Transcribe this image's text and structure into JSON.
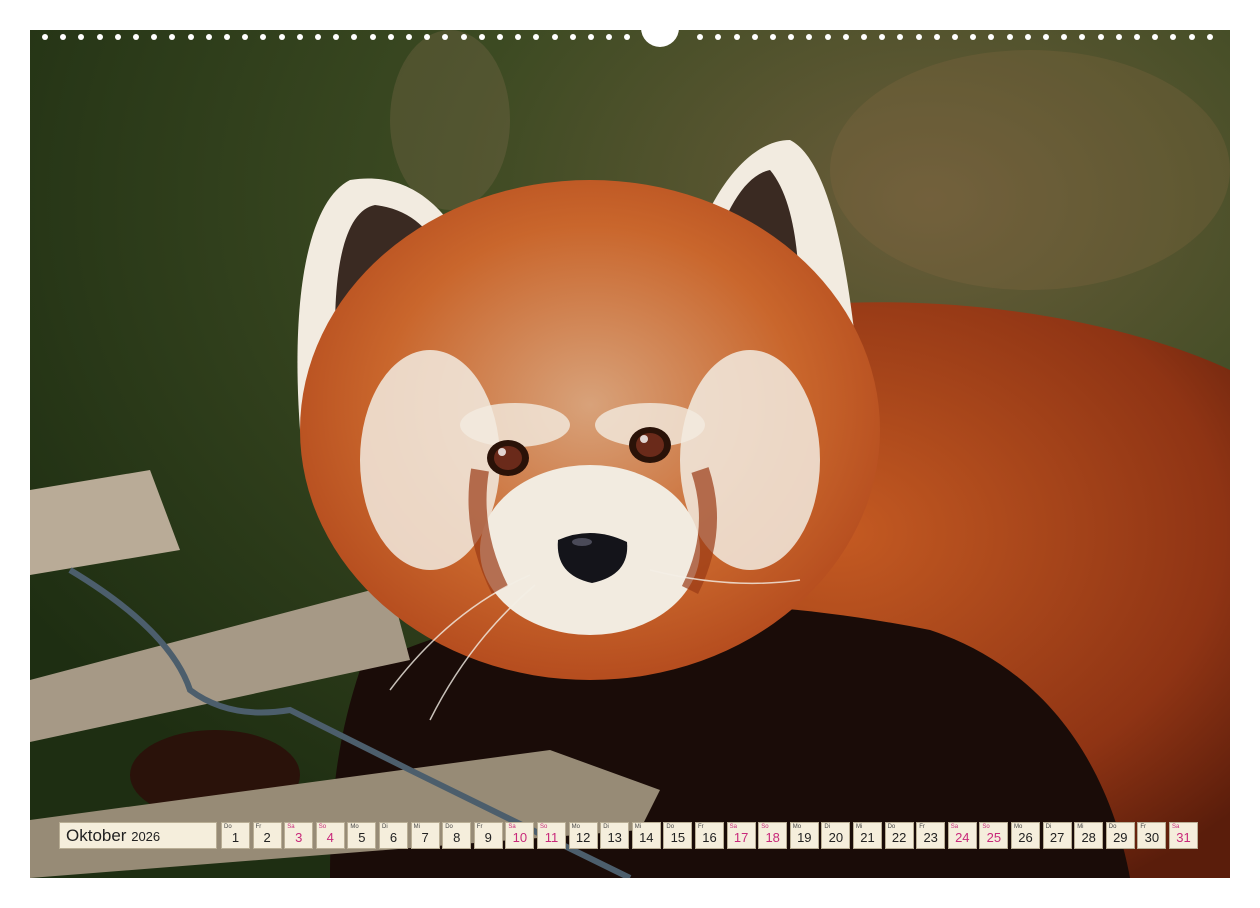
{
  "calendar": {
    "month": "Oktober",
    "year": "2026",
    "days": [
      {
        "wd": "Do",
        "n": "1",
        "we": false
      },
      {
        "wd": "Fr",
        "n": "2",
        "we": false
      },
      {
        "wd": "Sa",
        "n": "3",
        "we": true
      },
      {
        "wd": "So",
        "n": "4",
        "we": true
      },
      {
        "wd": "Mo",
        "n": "5",
        "we": false
      },
      {
        "wd": "Di",
        "n": "6",
        "we": false
      },
      {
        "wd": "Mi",
        "n": "7",
        "we": false
      },
      {
        "wd": "Do",
        "n": "8",
        "we": false
      },
      {
        "wd": "Fr",
        "n": "9",
        "we": false
      },
      {
        "wd": "Sa",
        "n": "10",
        "we": true
      },
      {
        "wd": "So",
        "n": "11",
        "we": true
      },
      {
        "wd": "Mo",
        "n": "12",
        "we": false
      },
      {
        "wd": "Di",
        "n": "13",
        "we": false
      },
      {
        "wd": "Mi",
        "n": "14",
        "we": false
      },
      {
        "wd": "Do",
        "n": "15",
        "we": false
      },
      {
        "wd": "Fr",
        "n": "16",
        "we": false
      },
      {
        "wd": "Sa",
        "n": "17",
        "we": true
      },
      {
        "wd": "So",
        "n": "18",
        "we": true
      },
      {
        "wd": "Mo",
        "n": "19",
        "we": false
      },
      {
        "wd": "Di",
        "n": "20",
        "we": false
      },
      {
        "wd": "Mi",
        "n": "21",
        "we": false
      },
      {
        "wd": "Do",
        "n": "22",
        "we": false
      },
      {
        "wd": "Fr",
        "n": "23",
        "we": false
      },
      {
        "wd": "Sa",
        "n": "24",
        "we": true
      },
      {
        "wd": "So",
        "n": "25",
        "we": true
      },
      {
        "wd": "Mo",
        "n": "26",
        "we": false
      },
      {
        "wd": "Di",
        "n": "27",
        "we": false
      },
      {
        "wd": "Mi",
        "n": "28",
        "we": false
      },
      {
        "wd": "Do",
        "n": "29",
        "we": false
      },
      {
        "wd": "Fr",
        "n": "30",
        "we": false
      },
      {
        "wd": "Sa",
        "n": "31",
        "we": true
      }
    ]
  },
  "colors": {
    "weekend": "#c8297a",
    "cell_bg": "#f5eedc",
    "fur_red": "#b8491a",
    "fur_white": "#f2ebe0"
  }
}
